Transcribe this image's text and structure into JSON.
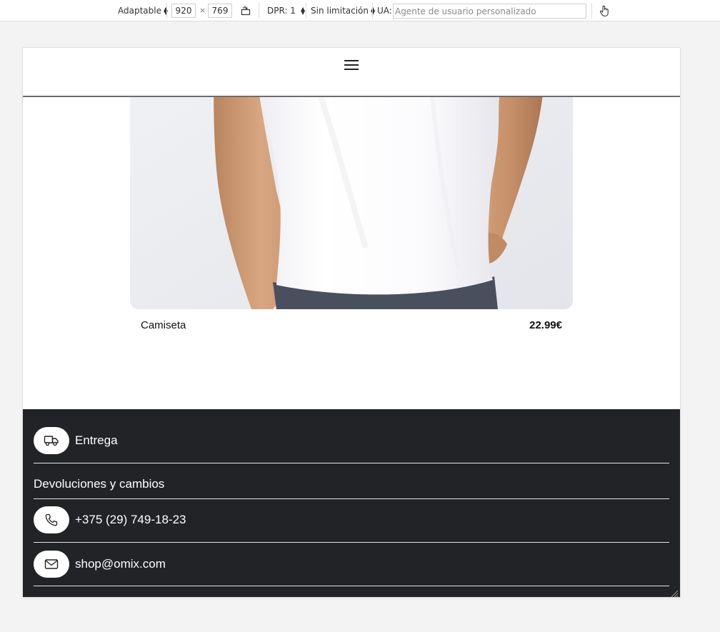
{
  "devtools": {
    "device_mode": "Adaptable",
    "width": "920",
    "times_symbol": "×",
    "height": "769",
    "dpr": "DPR: 1",
    "throttling": "Sin limitación",
    "ua_label": "UA:",
    "ua_placeholder": "Agente de usuario personalizado",
    "icons": [
      "rotate-icon",
      "touch-icon"
    ]
  },
  "page": {
    "header": {
      "menu_icon": "hamburger-icon"
    },
    "product": {
      "name": "Camiseta",
      "price": "22.99€"
    },
    "footer": {
      "items": [
        {
          "label": "Entrega",
          "icon": "truck-icon"
        },
        {
          "label": "Devoluciones y cambios"
        },
        {
          "label": "+375 (29) 749-18-23",
          "icon": "phone-icon"
        },
        {
          "label": "shop@omix.com",
          "icon": "mail-icon"
        }
      ]
    }
  },
  "colors": {
    "footer_bg": "#212326",
    "page_bg": "#f3f3f3",
    "toolbar_bg": "#ffffff"
  }
}
